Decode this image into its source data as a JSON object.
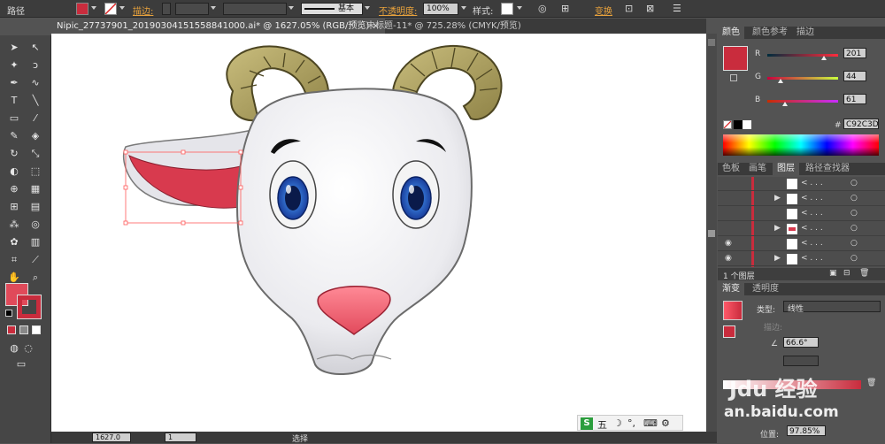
{
  "control_bar": {
    "object_type": "路径",
    "stroke_label": "描边:",
    "stroke_style": "基本",
    "opacity_label": "不透明度:",
    "opacity_value": "100%",
    "style_label": "样式:",
    "transform_label": "变换"
  },
  "tabs": [
    {
      "label": "Nipic_27737901_20190304151558841000.ai* @ 1627.05% (RGB/预览)",
      "active": true
    },
    {
      "label": "未标题-11* @ 725.28% (CMYK/预览)",
      "active": false
    }
  ],
  "color_panel": {
    "tabs": [
      "颜色",
      "颜色参考",
      "描边"
    ],
    "r_label": "R",
    "r_value": "201",
    "g_label": "G",
    "g_value": "44",
    "b_label": "B",
    "b_value": "61",
    "hex_label": "#",
    "hex_value": "C92C3D",
    "fill_color": "#c92c3d"
  },
  "layers_panel": {
    "tabs": [
      "色板",
      "画笔",
      "图层",
      "路径查找器"
    ],
    "rows": [
      "< . . .",
      "< . . .",
      "< . . .",
      "< . . .",
      "< . . .",
      "< . . ."
    ],
    "footer": "1 个图层"
  },
  "gradient_panel": {
    "tabs": [
      "渐变",
      "透明度"
    ],
    "type_label": "类型:",
    "type_value": "线性",
    "stroke_label": "描边:",
    "angle_value": "66.6°",
    "position_label": "位置:",
    "position_value": "97.85%"
  },
  "status_bar": {
    "zoom": "1627.0",
    "artboard": "1",
    "tool": "选择"
  },
  "ime_bar": {
    "text": "五"
  },
  "watermark": {
    "line1": "Jdu 经验",
    "line2": "an.baidu.com"
  }
}
